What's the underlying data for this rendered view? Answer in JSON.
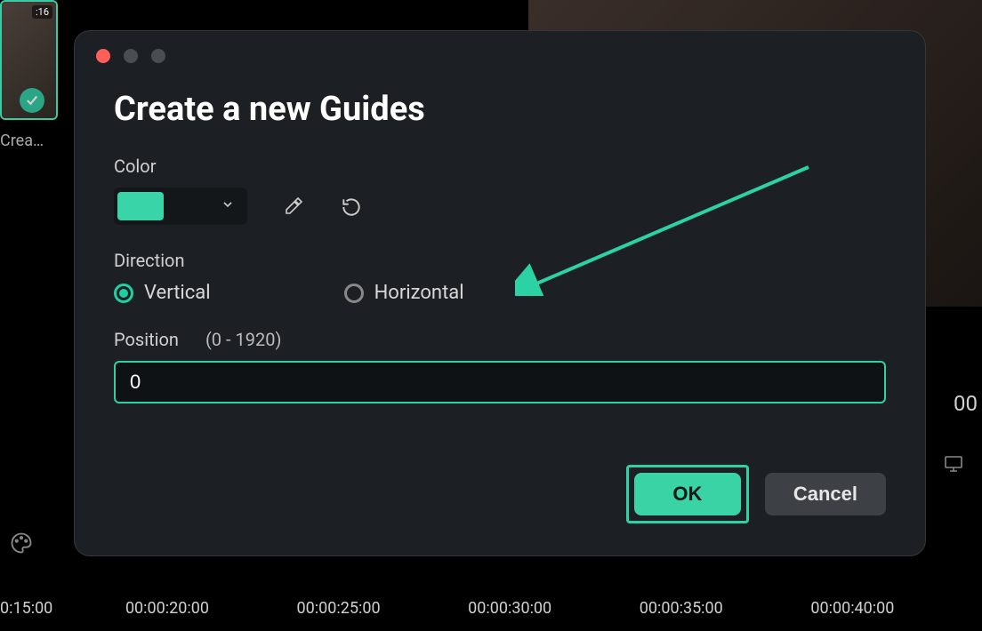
{
  "background": {
    "thumb_time": ":16",
    "thumb_label": "Crea…",
    "preview_timestamp": "00"
  },
  "timeline": {
    "marks": [
      "0:15:00",
      "00:00:20:00",
      "00:00:25:00",
      "00:00:30:00",
      "00:00:35:00",
      "00:00:40:00"
    ]
  },
  "modal": {
    "title": "Create a new Guides",
    "color_label": "Color",
    "color_value": "#39d4a8",
    "direction_label": "Direction",
    "direction_options": {
      "vertical": "Vertical",
      "horizontal": "Horizontal"
    },
    "direction_selected": "vertical",
    "position_label": "Position",
    "position_range": "(0 - 1920)",
    "position_value": "0",
    "ok_label": "OK",
    "cancel_label": "Cancel"
  }
}
